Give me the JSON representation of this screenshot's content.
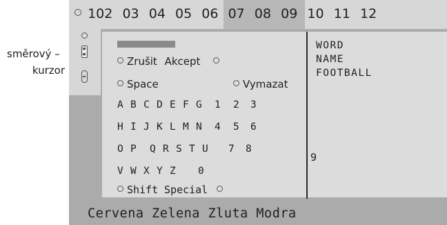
{
  "annotation": {
    "line1": "směrový –",
    "line2": "kurzor"
  },
  "page_numbers": [
    "102",
    "03",
    "04",
    "05",
    "06",
    "07",
    "08",
    "09",
    "10",
    "11",
    "12"
  ],
  "menu": {
    "zrusit": "Zrušit",
    "akcept": "Akcept",
    "space": "Space",
    "vymazat": "Vymazat",
    "shift": "Shift",
    "special": "Special"
  },
  "keyboard": {
    "rows": [
      [
        "A",
        "B",
        "C",
        "D",
        "E",
        "F",
        "G",
        "1",
        "2",
        "3"
      ],
      [
        "H",
        "I",
        "J",
        "K",
        "L",
        "M",
        "N",
        "4",
        "5",
        "6"
      ],
      [
        "O",
        "P",
        "Q",
        "R",
        "S",
        "T",
        "U",
        "7",
        "8"
      ],
      [
        "V",
        "W",
        "X",
        "Y",
        "Z",
        "0"
      ]
    ]
  },
  "side_words": [
    "WORD",
    "NAME",
    "FOOTBALL"
  ],
  "side_key": "9",
  "color_keys": [
    "Cervena",
    "Zelena",
    "Zluta",
    "Modra"
  ]
}
